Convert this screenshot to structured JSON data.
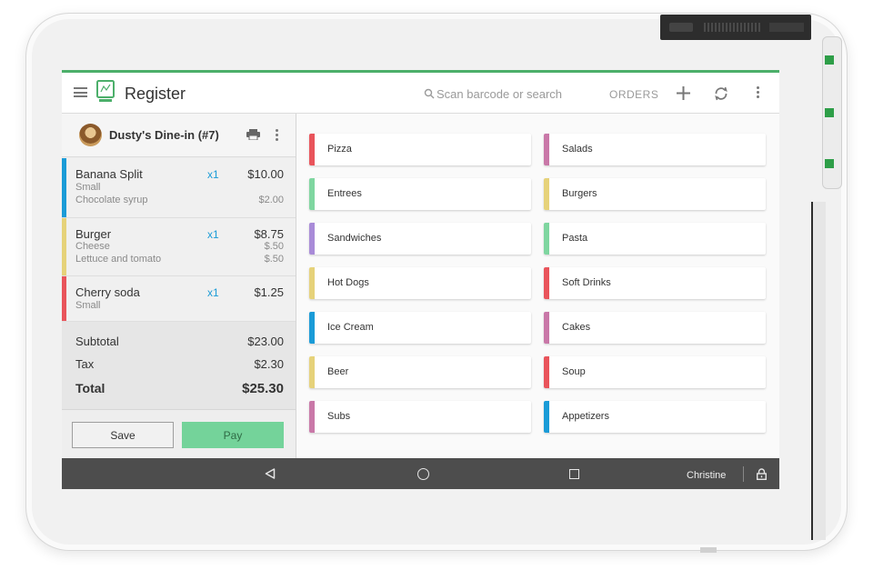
{
  "app": {
    "title": "Register"
  },
  "search": {
    "placeholder": "Scan barcode or search"
  },
  "toolbar": {
    "orders_label": "ORDERS"
  },
  "order": {
    "title": "Dusty's Dine-in (#7)",
    "items": [
      {
        "name": "Banana Split",
        "qty": "x1",
        "price": "$10.00",
        "accent": "#1a9bd7",
        "modifiers": [
          {
            "name": "Small",
            "price": ""
          },
          {
            "name": "Chocolate syrup",
            "price": "$2.00"
          }
        ]
      },
      {
        "name": "Burger",
        "qty": "x1",
        "price": "$8.75",
        "accent": "#e6d27a",
        "modifiers": [
          {
            "name": "Cheese",
            "price": "$.50"
          },
          {
            "name": "Lettuce and tomato",
            "price": "$.50"
          }
        ]
      },
      {
        "name": "Cherry soda",
        "qty": "x1",
        "price": "$1.25",
        "accent": "#e9545b",
        "modifiers": [
          {
            "name": "Small",
            "price": ""
          }
        ]
      }
    ],
    "totals": {
      "subtotal_label": "Subtotal",
      "subtotal": "$23.00",
      "tax_label": "Tax",
      "tax": "$2.30",
      "total_label": "Total",
      "total": "$25.30"
    },
    "save_label": "Save",
    "pay_label": "Pay"
  },
  "categories": [
    {
      "name": "Pizza",
      "color": "#e9545b"
    },
    {
      "name": "Salads",
      "color": "#c978a8"
    },
    {
      "name": "Entrees",
      "color": "#7fd6a0"
    },
    {
      "name": "Burgers",
      "color": "#e6d27a"
    },
    {
      "name": "Sandwiches",
      "color": "#a98bd8"
    },
    {
      "name": "Pasta",
      "color": "#7fd6a0"
    },
    {
      "name": "Hot Dogs",
      "color": "#e6d27a"
    },
    {
      "name": "Soft Drinks",
      "color": "#e9545b"
    },
    {
      "name": "Ice Cream",
      "color": "#1a9bd7"
    },
    {
      "name": "Cakes",
      "color": "#c978a8"
    },
    {
      "name": "Beer",
      "color": "#e6d27a"
    },
    {
      "name": "Soup",
      "color": "#e9545b"
    },
    {
      "name": "Subs",
      "color": "#c978a8"
    },
    {
      "name": "Appetizers",
      "color": "#1a9bd7"
    }
  ],
  "navbar": {
    "user": "Christine"
  },
  "icons": {
    "menu": "menu-icon",
    "logo": "register-logo-icon",
    "search": "search-icon",
    "add": "plus-icon",
    "sync": "sync-icon",
    "more": "more-vert-icon",
    "print": "printer-icon",
    "back": "back-icon",
    "home": "home-icon",
    "recent": "recent-apps-icon",
    "lock": "lock-icon"
  },
  "colors": {
    "accent": "#4caf6a",
    "pay": "#74d39a",
    "qty": "#1a9bd7",
    "navbar": "#4d4d4d"
  }
}
